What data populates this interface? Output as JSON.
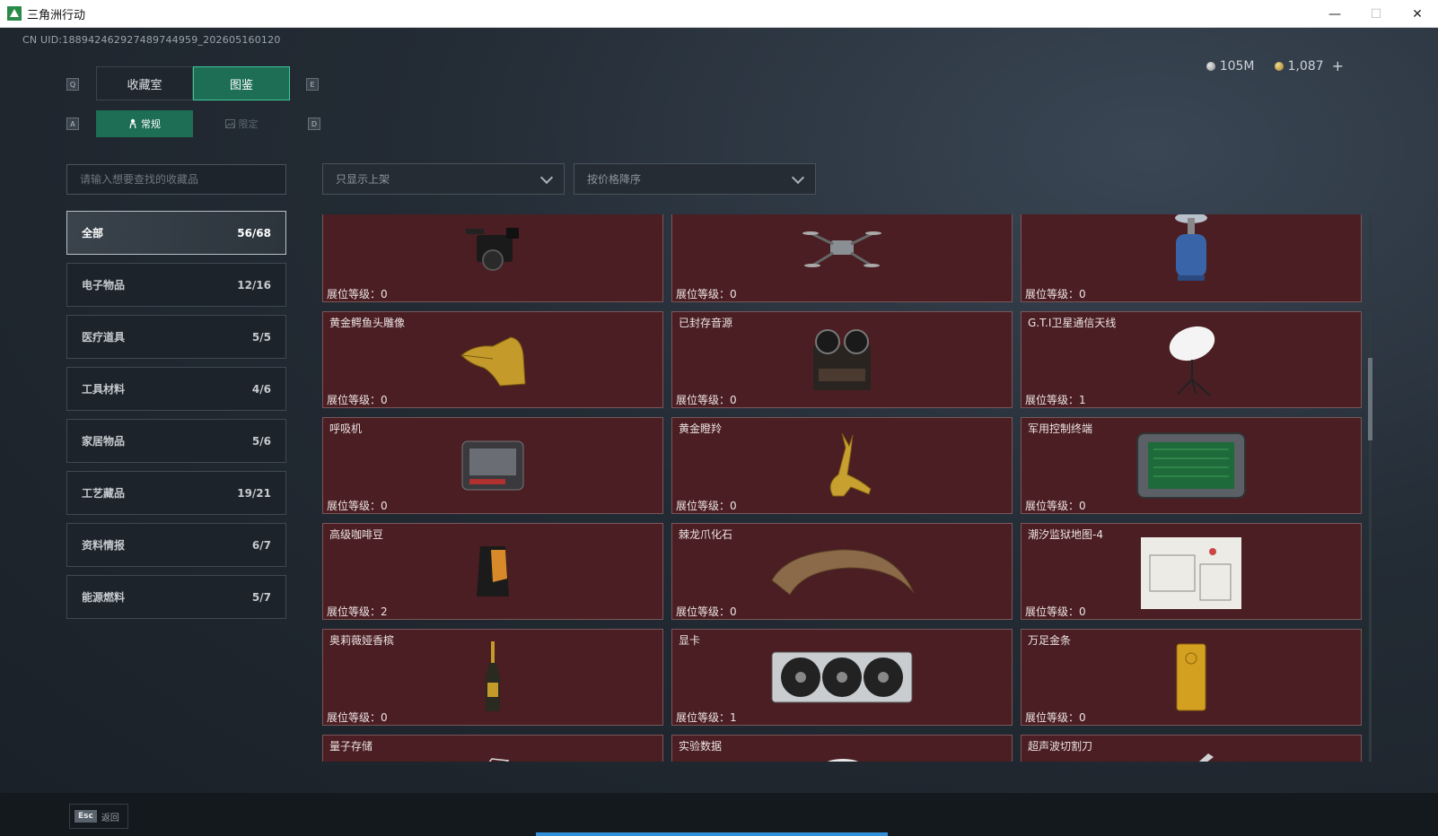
{
  "window": {
    "title": "三角洲行动",
    "minimize": "—",
    "maximize": "☐",
    "close": "✕"
  },
  "header": {
    "uid": "CN UID:18894246292748974495​9_202605160120",
    "currency": [
      {
        "icon": "silver-coin-icon",
        "value": "105M"
      },
      {
        "icon": "gold-coin-icon",
        "value": "1,087"
      }
    ],
    "add_label": "+"
  },
  "tabs": {
    "left_key": "Q",
    "right_key": "E",
    "items": [
      "收藏室",
      "图鉴"
    ],
    "active_index": 1
  },
  "subtabs": {
    "left_key": "A",
    "right_key": "D",
    "items": [
      {
        "label": "常规",
        "icon": "person-icon",
        "active": true
      },
      {
        "label": "限定",
        "icon": "image-icon",
        "active": false
      }
    ]
  },
  "search": {
    "placeholder": "请输入想要查找的收藏品"
  },
  "filters": {
    "shelf": "只显示上架",
    "sort": "按价格降序"
  },
  "categories": [
    {
      "name": "全部",
      "count": "56/68",
      "active": true
    },
    {
      "name": "电子物品",
      "count": "12/16"
    },
    {
      "name": "医疗道具",
      "count": "5/5"
    },
    {
      "name": "工具材料",
      "count": "4/6"
    },
    {
      "name": "家居物品",
      "count": "5/6"
    },
    {
      "name": "工艺藏品",
      "count": "19/21"
    },
    {
      "name": "资料情报",
      "count": "6/7"
    },
    {
      "name": "能源燃料",
      "count": "5/7"
    }
  ],
  "level_label": "展位等级：",
  "items": [
    {
      "name": "",
      "level": "0",
      "icon": "camera-icon"
    },
    {
      "name": "",
      "level": "0",
      "icon": "drone-icon"
    },
    {
      "name": "",
      "level": "0",
      "icon": "gas-canister-icon"
    },
    {
      "name": "黄金鳄鱼头雕像",
      "level": "0",
      "icon": "gold-crocodile-icon"
    },
    {
      "name": "已封存音源",
      "level": "0",
      "icon": "reel-recorder-icon"
    },
    {
      "name": "G.T.I卫星通信天线",
      "level": "1",
      "icon": "satellite-dish-icon"
    },
    {
      "name": "呼吸机",
      "level": "0",
      "icon": "ventilator-icon"
    },
    {
      "name": "黄金瞪羚",
      "level": "0",
      "icon": "gold-gazelle-icon"
    },
    {
      "name": "军用控制终端",
      "level": "0",
      "icon": "tablet-terminal-icon"
    },
    {
      "name": "高级咖啡豆",
      "level": "2",
      "icon": "coffee-bag-icon"
    },
    {
      "name": "棘龙爪化石",
      "level": "0",
      "icon": "claw-fossil-icon"
    },
    {
      "name": "潮汐监狱地图-4",
      "level": "0",
      "icon": "map-icon"
    },
    {
      "name": "奥莉薇娅香槟",
      "level": "0",
      "icon": "champagne-icon"
    },
    {
      "name": "显卡",
      "level": "1",
      "icon": "graphics-card-icon"
    },
    {
      "name": "万足金条",
      "level": "0",
      "icon": "gold-bar-icon"
    },
    {
      "name": "量子存储",
      "level": "",
      "icon": "quantum-storage-icon"
    },
    {
      "name": "实验数据",
      "level": "",
      "icon": "data-disc-icon"
    },
    {
      "name": "超声波切割刀",
      "level": "",
      "icon": "ultrasonic-knife-icon"
    }
  ],
  "footer": {
    "esc_key": "Esc",
    "back_label": "返回"
  }
}
